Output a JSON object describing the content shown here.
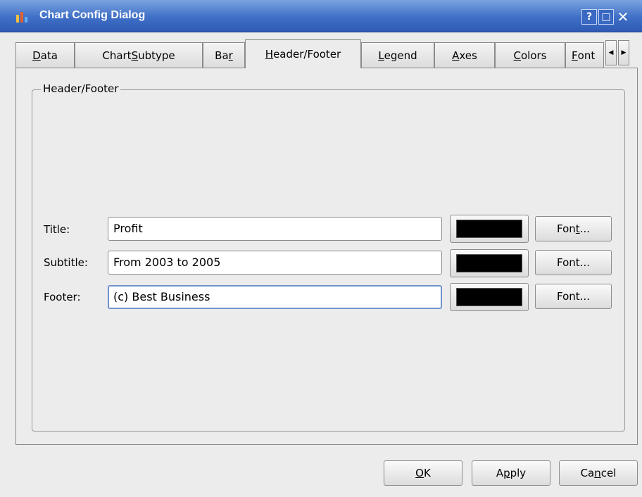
{
  "window": {
    "title": "Chart Config Dialog",
    "help_glyph": "?",
    "maximize_glyph": "□",
    "close_glyph": "✕"
  },
  "tabs": [
    {
      "pre": "",
      "mn": "D",
      "post": "ata"
    },
    {
      "pre": "Chart ",
      "mn": "S",
      "post": "ubtype"
    },
    {
      "pre": "Ba",
      "mn": "r",
      "post": ""
    },
    {
      "pre": "",
      "mn": "H",
      "post": "eader/Footer"
    },
    {
      "pre": "",
      "mn": "L",
      "post": "egend"
    },
    {
      "pre": "",
      "mn": "A",
      "post": "xes"
    },
    {
      "pre": "",
      "mn": "C",
      "post": "olors"
    },
    {
      "pre": "",
      "mn": "F",
      "post": "ont"
    }
  ],
  "tab_scroll": {
    "left": "◀",
    "right": "▶"
  },
  "group_title": "Header/Footer",
  "rows": [
    {
      "label": "Title:",
      "value": "Profit",
      "swatch_color": "#000000",
      "font_btn": {
        "pre": "Fon",
        "mn": "t",
        "post": "..."
      }
    },
    {
      "label": "Subtitle:",
      "value": "From 2003 to 2005",
      "swatch_color": "#000000",
      "font_btn": {
        "pre": "Font...",
        "mn": "",
        "post": ""
      }
    },
    {
      "label": "Footer:",
      "value": "(c) Best Business",
      "swatch_color": "#000000",
      "font_btn": {
        "pre": "Font...",
        "mn": "",
        "post": ""
      }
    }
  ],
  "buttons": {
    "ok": {
      "pre": "",
      "mn": "O",
      "post": "K"
    },
    "apply": {
      "pre": "A",
      "mn": "p",
      "post": "ply"
    },
    "cancel": {
      "pre": "Ca",
      "mn": "n",
      "post": "cel"
    }
  },
  "colors": {
    "titlebar": "#3f6fc6",
    "dialog_bg": "#ececec",
    "focus_border": "#6f93cf"
  }
}
